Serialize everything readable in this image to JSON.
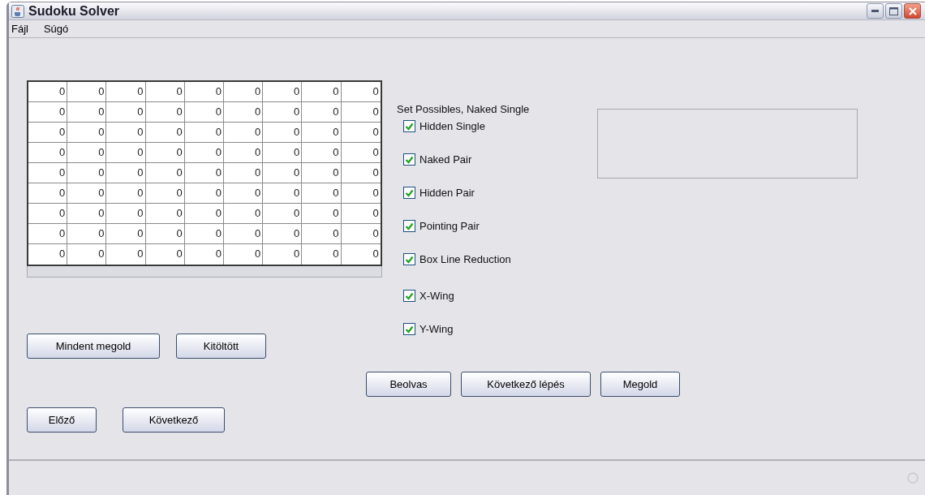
{
  "window": {
    "title": "Sudoku Solver"
  },
  "menu": [
    "Fájl",
    "Súgó"
  ],
  "grid": [
    [
      "0",
      "0",
      "0",
      "0",
      "0",
      "0",
      "0",
      "0",
      "0"
    ],
    [
      "0",
      "0",
      "0",
      "0",
      "0",
      "0",
      "0",
      "0",
      "0"
    ],
    [
      "0",
      "0",
      "0",
      "0",
      "0",
      "0",
      "0",
      "0",
      "0"
    ],
    [
      "0",
      "0",
      "0",
      "0",
      "0",
      "0",
      "0",
      "0",
      "0"
    ],
    [
      "0",
      "0",
      "0",
      "0",
      "0",
      "0",
      "0",
      "0",
      "0"
    ],
    [
      "0",
      "0",
      "0",
      "0",
      "0",
      "0",
      "0",
      "0",
      "0"
    ],
    [
      "0",
      "0",
      "0",
      "0",
      "0",
      "0",
      "0",
      "0",
      "0"
    ],
    [
      "0",
      "0",
      "0",
      "0",
      "0",
      "0",
      "0",
      "0",
      "0"
    ],
    [
      "0",
      "0",
      "0",
      "0",
      "0",
      "0",
      "0",
      "0",
      "0"
    ]
  ],
  "strategy_label": "Set Possibles, Naked Single",
  "strategies": [
    {
      "label": "Hidden Single",
      "checked": true
    },
    {
      "label": "Naked Pair",
      "checked": true
    },
    {
      "label": "Hidden Pair",
      "checked": true
    },
    {
      "label": "Pointing Pair",
      "checked": true
    },
    {
      "label": "Box Line Reduction",
      "checked": true
    },
    {
      "label": "X-Wing",
      "checked": true
    },
    {
      "label": "Y-Wing",
      "checked": true
    }
  ],
  "grid_buttons": [
    "Mindent megold",
    "Kitöltött"
  ],
  "step_buttons": [
    "Beolvas",
    "Következő lépés",
    "Megold"
  ],
  "history_buttons": [
    "Előző",
    "Következő"
  ]
}
